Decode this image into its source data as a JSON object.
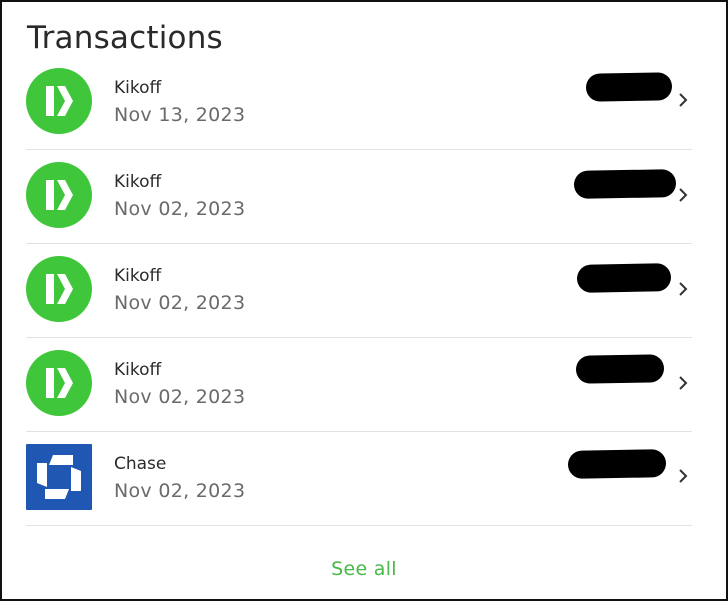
{
  "header": {
    "title": "Transactions"
  },
  "colors": {
    "kikoff_green": "#3fc63a",
    "chase_blue": "#1f57b3",
    "link_green": "#46b946",
    "redaction": "#000000"
  },
  "transactions": [
    {
      "merchant": "Kikoff",
      "date": "Nov 13, 2023",
      "logo": "kikoff-logo-icon",
      "amount": "redacted"
    },
    {
      "merchant": "Kikoff",
      "date": "Nov 02, 2023",
      "logo": "kikoff-logo-icon",
      "amount": "redacted"
    },
    {
      "merchant": "Kikoff",
      "date": "Nov 02, 2023",
      "logo": "kikoff-logo-icon",
      "amount": "redacted"
    },
    {
      "merchant": "Kikoff",
      "date": "Nov 02, 2023",
      "logo": "kikoff-logo-icon",
      "amount": "redacted"
    },
    {
      "merchant": "Chase",
      "date": "Nov 02, 2023",
      "logo": "chase-logo-icon",
      "amount": "redacted"
    }
  ],
  "footer": {
    "see_all_label": "See all"
  },
  "icons": {
    "row_arrow": "chevron-right-icon"
  }
}
